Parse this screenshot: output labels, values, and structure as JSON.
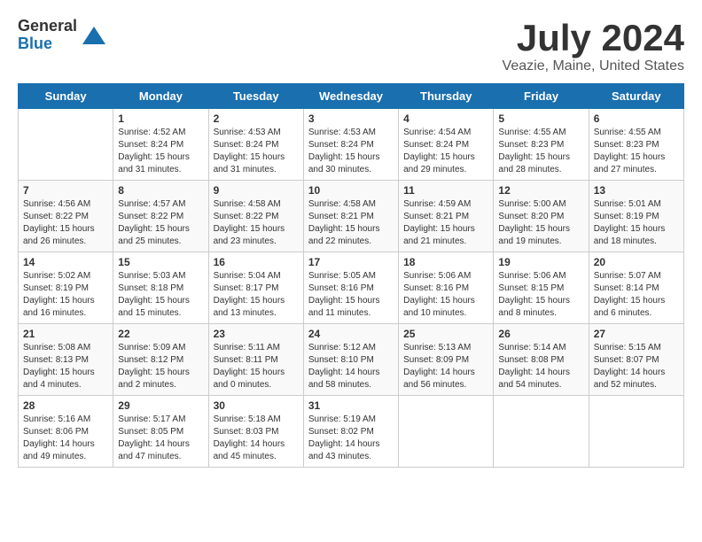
{
  "logo": {
    "general": "General",
    "blue": "Blue"
  },
  "title": {
    "month": "July 2024",
    "location": "Veazie, Maine, United States"
  },
  "days_of_week": [
    "Sunday",
    "Monday",
    "Tuesday",
    "Wednesday",
    "Thursday",
    "Friday",
    "Saturday"
  ],
  "weeks": [
    [
      {
        "day": "",
        "info": ""
      },
      {
        "day": "1",
        "info": "Sunrise: 4:52 AM\nSunset: 8:24 PM\nDaylight: 15 hours\nand 31 minutes."
      },
      {
        "day": "2",
        "info": "Sunrise: 4:53 AM\nSunset: 8:24 PM\nDaylight: 15 hours\nand 31 minutes."
      },
      {
        "day": "3",
        "info": "Sunrise: 4:53 AM\nSunset: 8:24 PM\nDaylight: 15 hours\nand 30 minutes."
      },
      {
        "day": "4",
        "info": "Sunrise: 4:54 AM\nSunset: 8:24 PM\nDaylight: 15 hours\nand 29 minutes."
      },
      {
        "day": "5",
        "info": "Sunrise: 4:55 AM\nSunset: 8:23 PM\nDaylight: 15 hours\nand 28 minutes."
      },
      {
        "day": "6",
        "info": "Sunrise: 4:55 AM\nSunset: 8:23 PM\nDaylight: 15 hours\nand 27 minutes."
      }
    ],
    [
      {
        "day": "7",
        "info": "Sunrise: 4:56 AM\nSunset: 8:22 PM\nDaylight: 15 hours\nand 26 minutes."
      },
      {
        "day": "8",
        "info": "Sunrise: 4:57 AM\nSunset: 8:22 PM\nDaylight: 15 hours\nand 25 minutes."
      },
      {
        "day": "9",
        "info": "Sunrise: 4:58 AM\nSunset: 8:22 PM\nDaylight: 15 hours\nand 23 minutes."
      },
      {
        "day": "10",
        "info": "Sunrise: 4:58 AM\nSunset: 8:21 PM\nDaylight: 15 hours\nand 22 minutes."
      },
      {
        "day": "11",
        "info": "Sunrise: 4:59 AM\nSunset: 8:21 PM\nDaylight: 15 hours\nand 21 minutes."
      },
      {
        "day": "12",
        "info": "Sunrise: 5:00 AM\nSunset: 8:20 PM\nDaylight: 15 hours\nand 19 minutes."
      },
      {
        "day": "13",
        "info": "Sunrise: 5:01 AM\nSunset: 8:19 PM\nDaylight: 15 hours\nand 18 minutes."
      }
    ],
    [
      {
        "day": "14",
        "info": "Sunrise: 5:02 AM\nSunset: 8:19 PM\nDaylight: 15 hours\nand 16 minutes."
      },
      {
        "day": "15",
        "info": "Sunrise: 5:03 AM\nSunset: 8:18 PM\nDaylight: 15 hours\nand 15 minutes."
      },
      {
        "day": "16",
        "info": "Sunrise: 5:04 AM\nSunset: 8:17 PM\nDaylight: 15 hours\nand 13 minutes."
      },
      {
        "day": "17",
        "info": "Sunrise: 5:05 AM\nSunset: 8:16 PM\nDaylight: 15 hours\nand 11 minutes."
      },
      {
        "day": "18",
        "info": "Sunrise: 5:06 AM\nSunset: 8:16 PM\nDaylight: 15 hours\nand 10 minutes."
      },
      {
        "day": "19",
        "info": "Sunrise: 5:06 AM\nSunset: 8:15 PM\nDaylight: 15 hours\nand 8 minutes."
      },
      {
        "day": "20",
        "info": "Sunrise: 5:07 AM\nSunset: 8:14 PM\nDaylight: 15 hours\nand 6 minutes."
      }
    ],
    [
      {
        "day": "21",
        "info": "Sunrise: 5:08 AM\nSunset: 8:13 PM\nDaylight: 15 hours\nand 4 minutes."
      },
      {
        "day": "22",
        "info": "Sunrise: 5:09 AM\nSunset: 8:12 PM\nDaylight: 15 hours\nand 2 minutes."
      },
      {
        "day": "23",
        "info": "Sunrise: 5:11 AM\nSunset: 8:11 PM\nDaylight: 15 hours\nand 0 minutes."
      },
      {
        "day": "24",
        "info": "Sunrise: 5:12 AM\nSunset: 8:10 PM\nDaylight: 14 hours\nand 58 minutes."
      },
      {
        "day": "25",
        "info": "Sunrise: 5:13 AM\nSunset: 8:09 PM\nDaylight: 14 hours\nand 56 minutes."
      },
      {
        "day": "26",
        "info": "Sunrise: 5:14 AM\nSunset: 8:08 PM\nDaylight: 14 hours\nand 54 minutes."
      },
      {
        "day": "27",
        "info": "Sunrise: 5:15 AM\nSunset: 8:07 PM\nDaylight: 14 hours\nand 52 minutes."
      }
    ],
    [
      {
        "day": "28",
        "info": "Sunrise: 5:16 AM\nSunset: 8:06 PM\nDaylight: 14 hours\nand 49 minutes."
      },
      {
        "day": "29",
        "info": "Sunrise: 5:17 AM\nSunset: 8:05 PM\nDaylight: 14 hours\nand 47 minutes."
      },
      {
        "day": "30",
        "info": "Sunrise: 5:18 AM\nSunset: 8:03 PM\nDaylight: 14 hours\nand 45 minutes."
      },
      {
        "day": "31",
        "info": "Sunrise: 5:19 AM\nSunset: 8:02 PM\nDaylight: 14 hours\nand 43 minutes."
      },
      {
        "day": "",
        "info": ""
      },
      {
        "day": "",
        "info": ""
      },
      {
        "day": "",
        "info": ""
      }
    ]
  ]
}
